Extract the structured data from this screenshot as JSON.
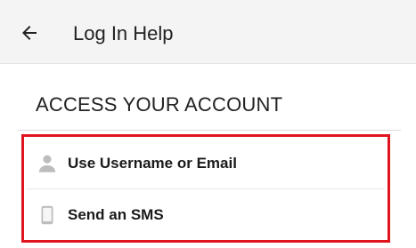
{
  "header": {
    "back_icon": "arrow-left-icon",
    "title": "Log In Help"
  },
  "section": {
    "title": "ACCESS YOUR ACCOUNT"
  },
  "options": [
    {
      "label": "Use Username or Email",
      "icon": "person-icon"
    },
    {
      "label": "Send an SMS",
      "icon": "phone-icon"
    }
  ],
  "colors": {
    "highlight_border": "#e0141c",
    "appbar_bg": "#f4f4f4",
    "icon_gray": "#bdbdbd"
  }
}
